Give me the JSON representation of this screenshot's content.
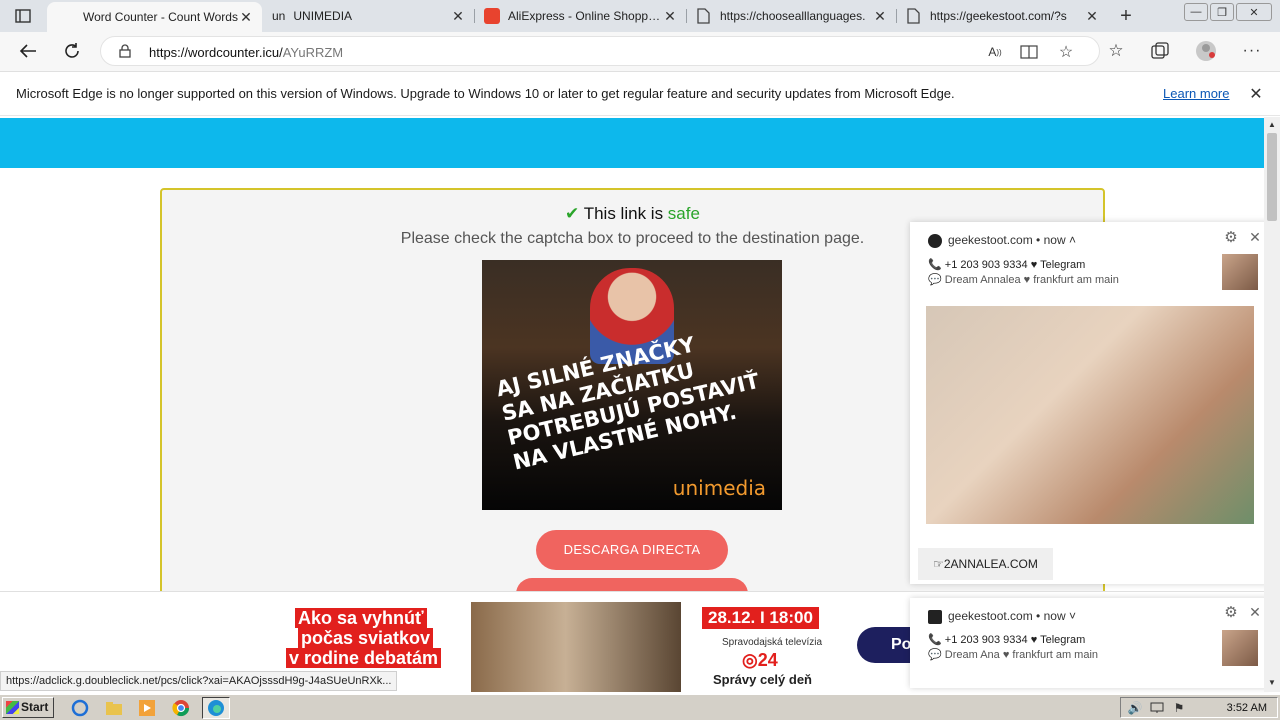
{
  "browser": {
    "tabs": [
      {
        "title": "Word Counter - Count Words",
        "active": true
      },
      {
        "title": "UNIMEDIA",
        "active": false
      },
      {
        "title": "AliExpress - Online Shopping",
        "active": false
      },
      {
        "title": "https://choosealllanguages.",
        "active": false
      },
      {
        "title": "https://geekestoot.com/?s",
        "active": false
      }
    ],
    "url_host": "https://wordcounter.icu/",
    "url_path": "AYuRRZM",
    "infobar_text": "Microsoft Edge is no longer supported on this version of Windows. Upgrade to Windows 10 or later to get regular feature and security updates from Microsoft Edge.",
    "infobar_link": "Learn more"
  },
  "page": {
    "safe_prefix": "This link is ",
    "safe_word": "safe",
    "captcha_text": "Please check the captcha box to proceed to the destination page.",
    "ad_text": [
      "AJ SILNÉ ZNAČKY",
      "SA NA ZAČIATKU",
      "POTREBUJÚ POSTAVIŤ",
      "NA VLASTNÉ NOHY."
    ],
    "ad_brand": "unimedia",
    "download_button": "DESCARGA DIRECTA"
  },
  "notifications": [
    {
      "site": "geekestoot.com",
      "time": "now",
      "line1": "+1 203 903 9334 ♥ Telegram",
      "line2": "Dream Annalea ♥ frankfurt am main",
      "button": "☞2ANNALEA.COM"
    },
    {
      "site": "geekestoot.com",
      "time": "now",
      "line1": "+1 203 903 9334 ♥ Telegram",
      "line2": "Dream Ana ♥ frankfurt am main"
    }
  ],
  "bottom_ad": {
    "headline": [
      "Ako sa vyhnúť",
      "počas sviatkov",
      "v rodine debatám"
    ],
    "date": "28.12. I 18:00",
    "tv_line": "Spravodajská televízia",
    "tv_logo": "24",
    "tagline": "Správy celý deň",
    "button": "Po"
  },
  "status_url": "https://adclick.g.doubleclick.net/pcs/click?xai=AKAOjsssdH9g-J4aSUeUnRXk...",
  "taskbar": {
    "start": "Start",
    "clock": "3:52 AM"
  }
}
